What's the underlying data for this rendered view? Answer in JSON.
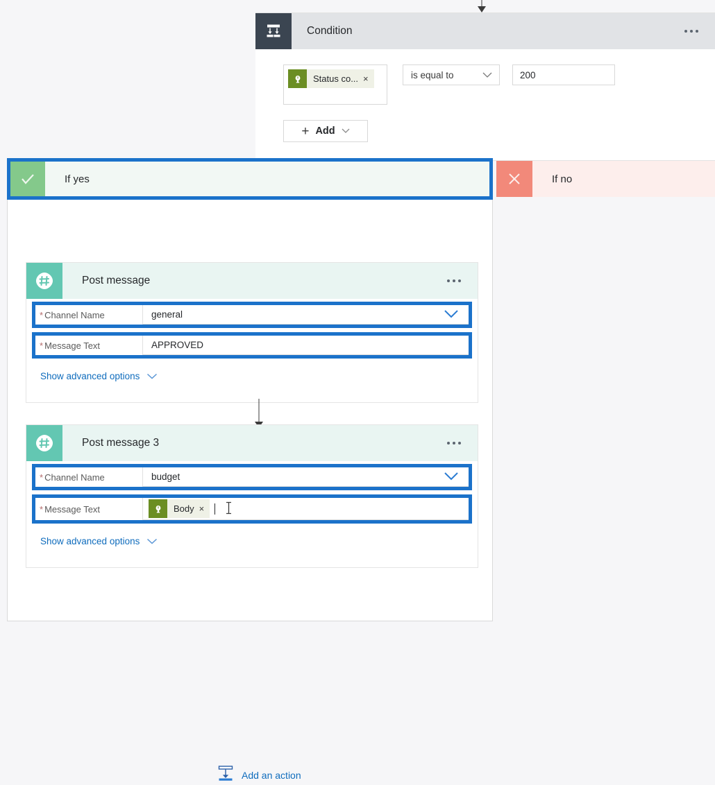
{
  "canvas": {
    "background": "#f6f6f8",
    "highlight_color": "#1b72ca"
  },
  "condition": {
    "title": "Condition",
    "icon": "condition-icon",
    "menu": "ellipsis-icon",
    "row": {
      "token": {
        "label": "Status co...",
        "close": "×",
        "icon": "http-connector-icon",
        "icon_color": "#6b8e23"
      },
      "operator": {
        "value": "is equal to",
        "chevron": "chevron-down-icon"
      },
      "value": "200"
    },
    "add_button": {
      "plus": "+",
      "label": "Add",
      "chevron": "chevron-down-icon"
    }
  },
  "branches": {
    "if_yes": {
      "label": "If yes",
      "icon": "check-icon",
      "icon_color": "#84c98b"
    },
    "if_no": {
      "label": "If no",
      "icon": "close-icon",
      "icon_color": "#f2897a"
    }
  },
  "actions": [
    {
      "title": "Post message",
      "icon": "slack-hash-icon",
      "menu": "ellipsis-icon",
      "fields": [
        {
          "required": "*",
          "label": "Channel Name",
          "value": "general",
          "control": "dropdown",
          "chevron": "chevron-down-icon"
        },
        {
          "required": "*",
          "label": "Message Text",
          "value": "APPROVED",
          "control": "text"
        }
      ],
      "advanced": {
        "label": "Show advanced options",
        "chevron": "chevron-down-icon"
      }
    },
    {
      "title": "Post message 3",
      "icon": "slack-hash-icon",
      "menu": "ellipsis-icon",
      "fields": [
        {
          "required": "*",
          "label": "Channel Name",
          "value": "budget",
          "control": "dropdown",
          "chevron": "chevron-down-icon"
        },
        {
          "required": "*",
          "label": "Message Text",
          "value": "",
          "control": "token",
          "token": {
            "label": "Body",
            "close": "×",
            "icon": "http-connector-icon",
            "icon_color": "#6b8e23"
          }
        }
      ],
      "advanced": {
        "label": "Show advanced options",
        "chevron": "chevron-down-icon"
      }
    }
  ],
  "add_action": {
    "label": "Add an action",
    "icon": "add-action-icon"
  }
}
